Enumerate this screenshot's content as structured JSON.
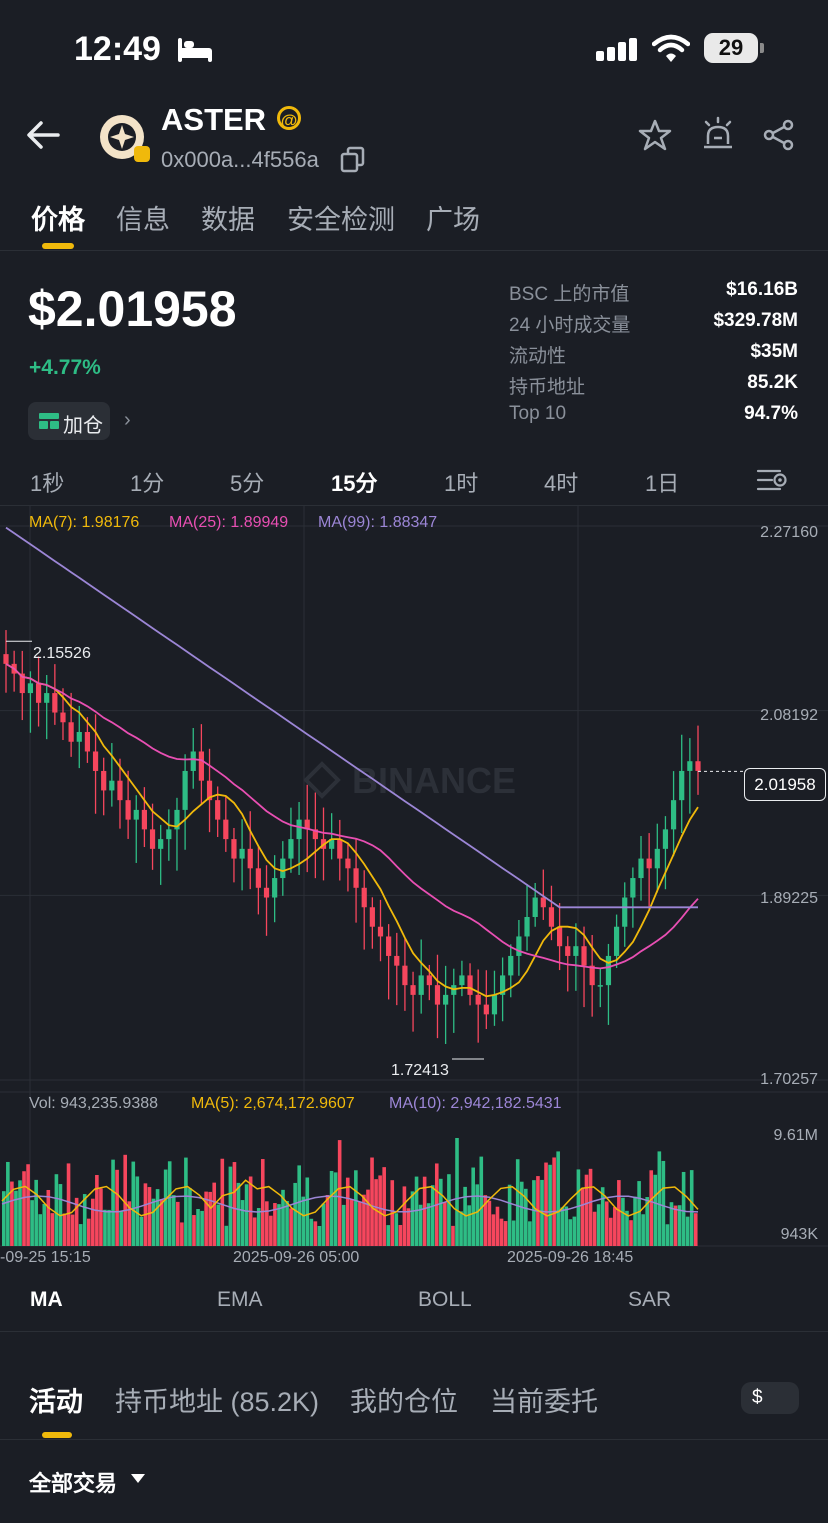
{
  "status_bar": {
    "time": "12:49",
    "battery": "29"
  },
  "header": {
    "token_name": "ASTER",
    "at_badge": "@",
    "address": "0x000a...4f556a"
  },
  "tabs": [
    "价格",
    "信息",
    "数据",
    "安全检测",
    "广场"
  ],
  "price": {
    "value": "$2.01958",
    "change": "+4.77%",
    "add_position_label": "加仓",
    "chevron": "›"
  },
  "stats": [
    {
      "label": "BSC 上的市值",
      "value": "$16.16B"
    },
    {
      "label": "24 小时成交量",
      "value": "$329.78M"
    },
    {
      "label": "流动性",
      "value": "$35M"
    },
    {
      "label": "持币地址",
      "value": "85.2K"
    },
    {
      "label": "Top 10",
      "value": "94.7%"
    }
  ],
  "timeframes": [
    "1秒",
    "1分",
    "5分",
    "15分",
    "1时",
    "4时",
    "1日"
  ],
  "chart": {
    "ma_labels": [
      "MA(7): 1.98176",
      "MA(25): 1.89949",
      "MA(99): 1.88347"
    ],
    "watermark": "BINANCE",
    "price_axis": [
      "2.27160",
      "2.08192",
      "1.89225",
      "1.70257"
    ],
    "current_price": "2.01958",
    "high_label": "2.15526",
    "low_label": "1.72413",
    "vol_labels": [
      "Vol: 943,235.9388",
      "MA(5): 2,674,172.9607",
      "MA(10): 2,942,182.5431"
    ],
    "vol_axis": [
      "9.61M",
      "943K"
    ],
    "dates": [
      "-09-25 15:15",
      "2025-09-26 05:00",
      "2025-09-26 18:45"
    ]
  },
  "indicators": [
    "MA",
    "EMA",
    "BOLL",
    "SAR"
  ],
  "bottom_tabs": [
    "活动",
    "持币地址 (85.2K)",
    "我的仓位",
    "当前委托"
  ],
  "currency_toggle": "$",
  "filter_label": "全部交易",
  "colors": {
    "up": "#2ebd85",
    "down": "#f6465d",
    "accent": "#f0b90b",
    "ma7": "#f0b90b",
    "ma25": "#e84fb3",
    "ma99": "#9c86d6"
  },
  "chart_data": {
    "type": "candlestick",
    "x_labels": [
      "09-25 15:15",
      "2025-09-26 05:00",
      "2025-09-26 18:45"
    ],
    "price_range": [
      1.70257,
      2.2716
    ],
    "current": 2.01958,
    "high": 2.15526,
    "low": 1.72413,
    "ma": {
      "MA7": 1.98176,
      "MA25": 1.89949,
      "MA99": 1.88347
    },
    "volume": {
      "latest": 943235.9388,
      "MA5": 2674172.9607,
      "MA10": 2942182.5431,
      "axis_max_label": "9.61M",
      "axis_min_label": "943K"
    },
    "closes": [
      2.13,
      2.12,
      2.1,
      2.11,
      2.09,
      2.1,
      2.08,
      2.07,
      2.05,
      2.06,
      2.04,
      2.02,
      2.0,
      2.01,
      1.99,
      1.97,
      1.98,
      1.96,
      1.94,
      1.95,
      1.96,
      1.98,
      2.02,
      2.04,
      2.01,
      1.99,
      1.97,
      1.95,
      1.93,
      1.94,
      1.92,
      1.9,
      1.89,
      1.91,
      1.93,
      1.95,
      1.97,
      1.96,
      1.95,
      1.94,
      1.95,
      1.93,
      1.92,
      1.9,
      1.88,
      1.86,
      1.85,
      1.83,
      1.82,
      1.8,
      1.79,
      1.81,
      1.8,
      1.78,
      1.79,
      1.8,
      1.81,
      1.79,
      1.78,
      1.77,
      1.79,
      1.81,
      1.83,
      1.85,
      1.87,
      1.89,
      1.88,
      1.86,
      1.84,
      1.83,
      1.84,
      1.82,
      1.8,
      1.8,
      1.83,
      1.86,
      1.89,
      1.91,
      1.93,
      1.92,
      1.94,
      1.96,
      1.99,
      2.02,
      2.03,
      2.02
    ]
  }
}
